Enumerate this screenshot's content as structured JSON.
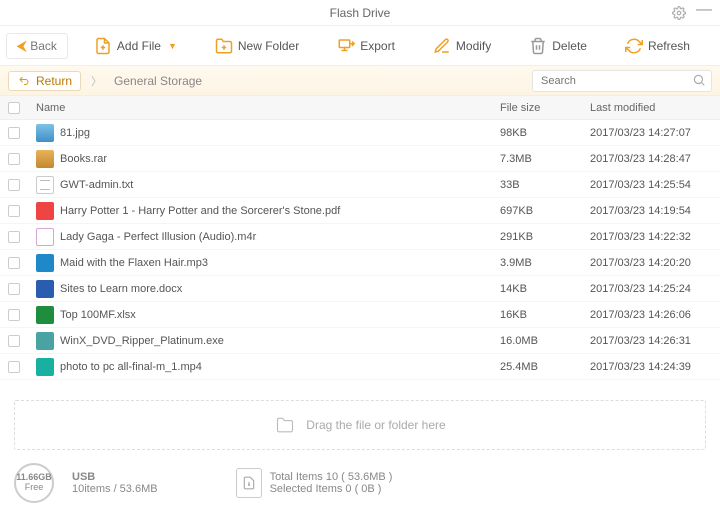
{
  "window": {
    "title": "Flash Drive"
  },
  "toolbar": {
    "back": "Back",
    "addFile": "Add File",
    "newFolder": "New Folder",
    "export": "Export",
    "modify": "Modify",
    "delete": "Delete",
    "refresh": "Refresh"
  },
  "breadcrumb": {
    "return": "Return",
    "path": "General Storage"
  },
  "search": {
    "placeholder": "Search"
  },
  "columns": {
    "name": "Name",
    "size": "File size",
    "modified": "Last modified"
  },
  "files": [
    {
      "name": "81.jpg",
      "size": "98KB",
      "modified": "2017/03/23 14:27:07",
      "icon": "ic-img"
    },
    {
      "name": "Books.rar",
      "size": "7.3MB",
      "modified": "2017/03/23 14:28:47",
      "icon": "ic-rar"
    },
    {
      "name": "GWT-admin.txt",
      "size": "33B",
      "modified": "2017/03/23 14:25:54",
      "icon": "ic-txt"
    },
    {
      "name": "Harry Potter 1 - Harry Potter and the Sorcerer's Stone.pdf",
      "size": "697KB",
      "modified": "2017/03/23 14:19:54",
      "icon": "ic-pdf"
    },
    {
      "name": "Lady Gaga - Perfect Illusion (Audio).m4r",
      "size": "291KB",
      "modified": "2017/03/23 14:22:32",
      "icon": "ic-audio"
    },
    {
      "name": "Maid with the Flaxen Hair.mp3",
      "size": "3.9MB",
      "modified": "2017/03/23 14:20:20",
      "icon": "ic-mp3"
    },
    {
      "name": "Sites to Learn  more.docx",
      "size": "14KB",
      "modified": "2017/03/23 14:25:24",
      "icon": "ic-doc"
    },
    {
      "name": "Top 100MF.xlsx",
      "size": "16KB",
      "modified": "2017/03/23 14:26:06",
      "icon": "ic-xls"
    },
    {
      "name": "WinX_DVD_Ripper_Platinum.exe",
      "size": "16.0MB",
      "modified": "2017/03/23 14:26:31",
      "icon": "ic-exe"
    },
    {
      "name": "photo to pc all-final-m_1.mp4",
      "size": "25.4MB",
      "modified": "2017/03/23 14:24:39",
      "icon": "ic-mp4"
    }
  ],
  "dropzone": {
    "hint": "Drag the file or folder here"
  },
  "footer": {
    "freeSpace": "11.66GB",
    "freeLabel": "Free",
    "driveType": "USB",
    "driveSummary": "10items / 53.6MB",
    "totalLine": "Total Items 10 ( 53.6MB )",
    "selectedLine": "Selected Items 0 ( 0B )"
  },
  "colors": {
    "accent": "#f0a020"
  }
}
